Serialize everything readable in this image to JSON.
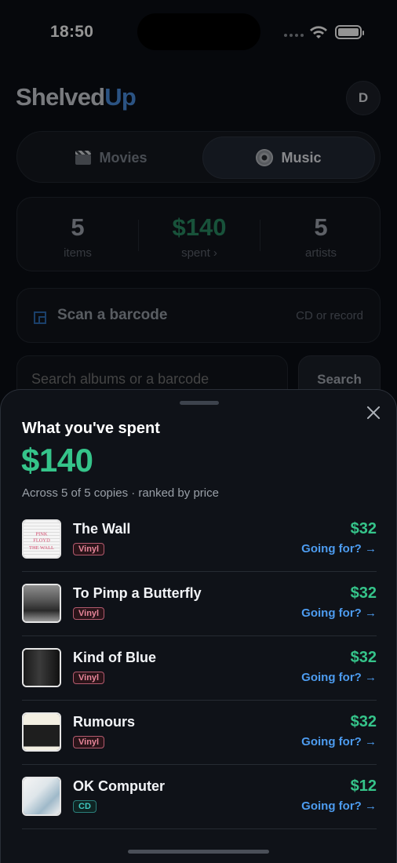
{
  "status": {
    "time": "18:50"
  },
  "header": {
    "logo_part1": "Shelved",
    "logo_part2": "Up",
    "avatar_initial": "D"
  },
  "tabs": [
    {
      "label": "Movies",
      "icon": "clapperboard-icon",
      "selected": false
    },
    {
      "label": "Music",
      "icon": "disc-icon",
      "selected": true
    }
  ],
  "stats": [
    {
      "value": "5",
      "label": "items"
    },
    {
      "value": "$140",
      "label": "spent ›"
    },
    {
      "value": "5",
      "label": "artists"
    }
  ],
  "scan": {
    "label": "Scan a barcode",
    "hint": "CD or record"
  },
  "search": {
    "placeholder": "Search albums or a barcode",
    "button": "Search"
  },
  "sheet": {
    "title": "What you've spent",
    "total": "$140",
    "subtitle": "Across 5 of 5 copies · ranked by price",
    "items": [
      {
        "title": "The Wall",
        "format": "Vinyl",
        "price": "$32",
        "action": "Going for? →"
      },
      {
        "title": "To Pimp a Butterfly",
        "format": "Vinyl",
        "price": "$32",
        "action": "Going for? →"
      },
      {
        "title": "Kind of Blue",
        "format": "Vinyl",
        "price": "$32",
        "action": "Going for? →"
      },
      {
        "title": "Rumours",
        "format": "Vinyl",
        "price": "$32",
        "action": "Going for? →"
      },
      {
        "title": "OK Computer",
        "format": "CD",
        "price": "$12",
        "action": "Going for? →"
      }
    ]
  },
  "colors": {
    "accent_green": "#35c48a",
    "link_blue": "#4d9cf0",
    "brand_blue": "#4a90e2"
  }
}
